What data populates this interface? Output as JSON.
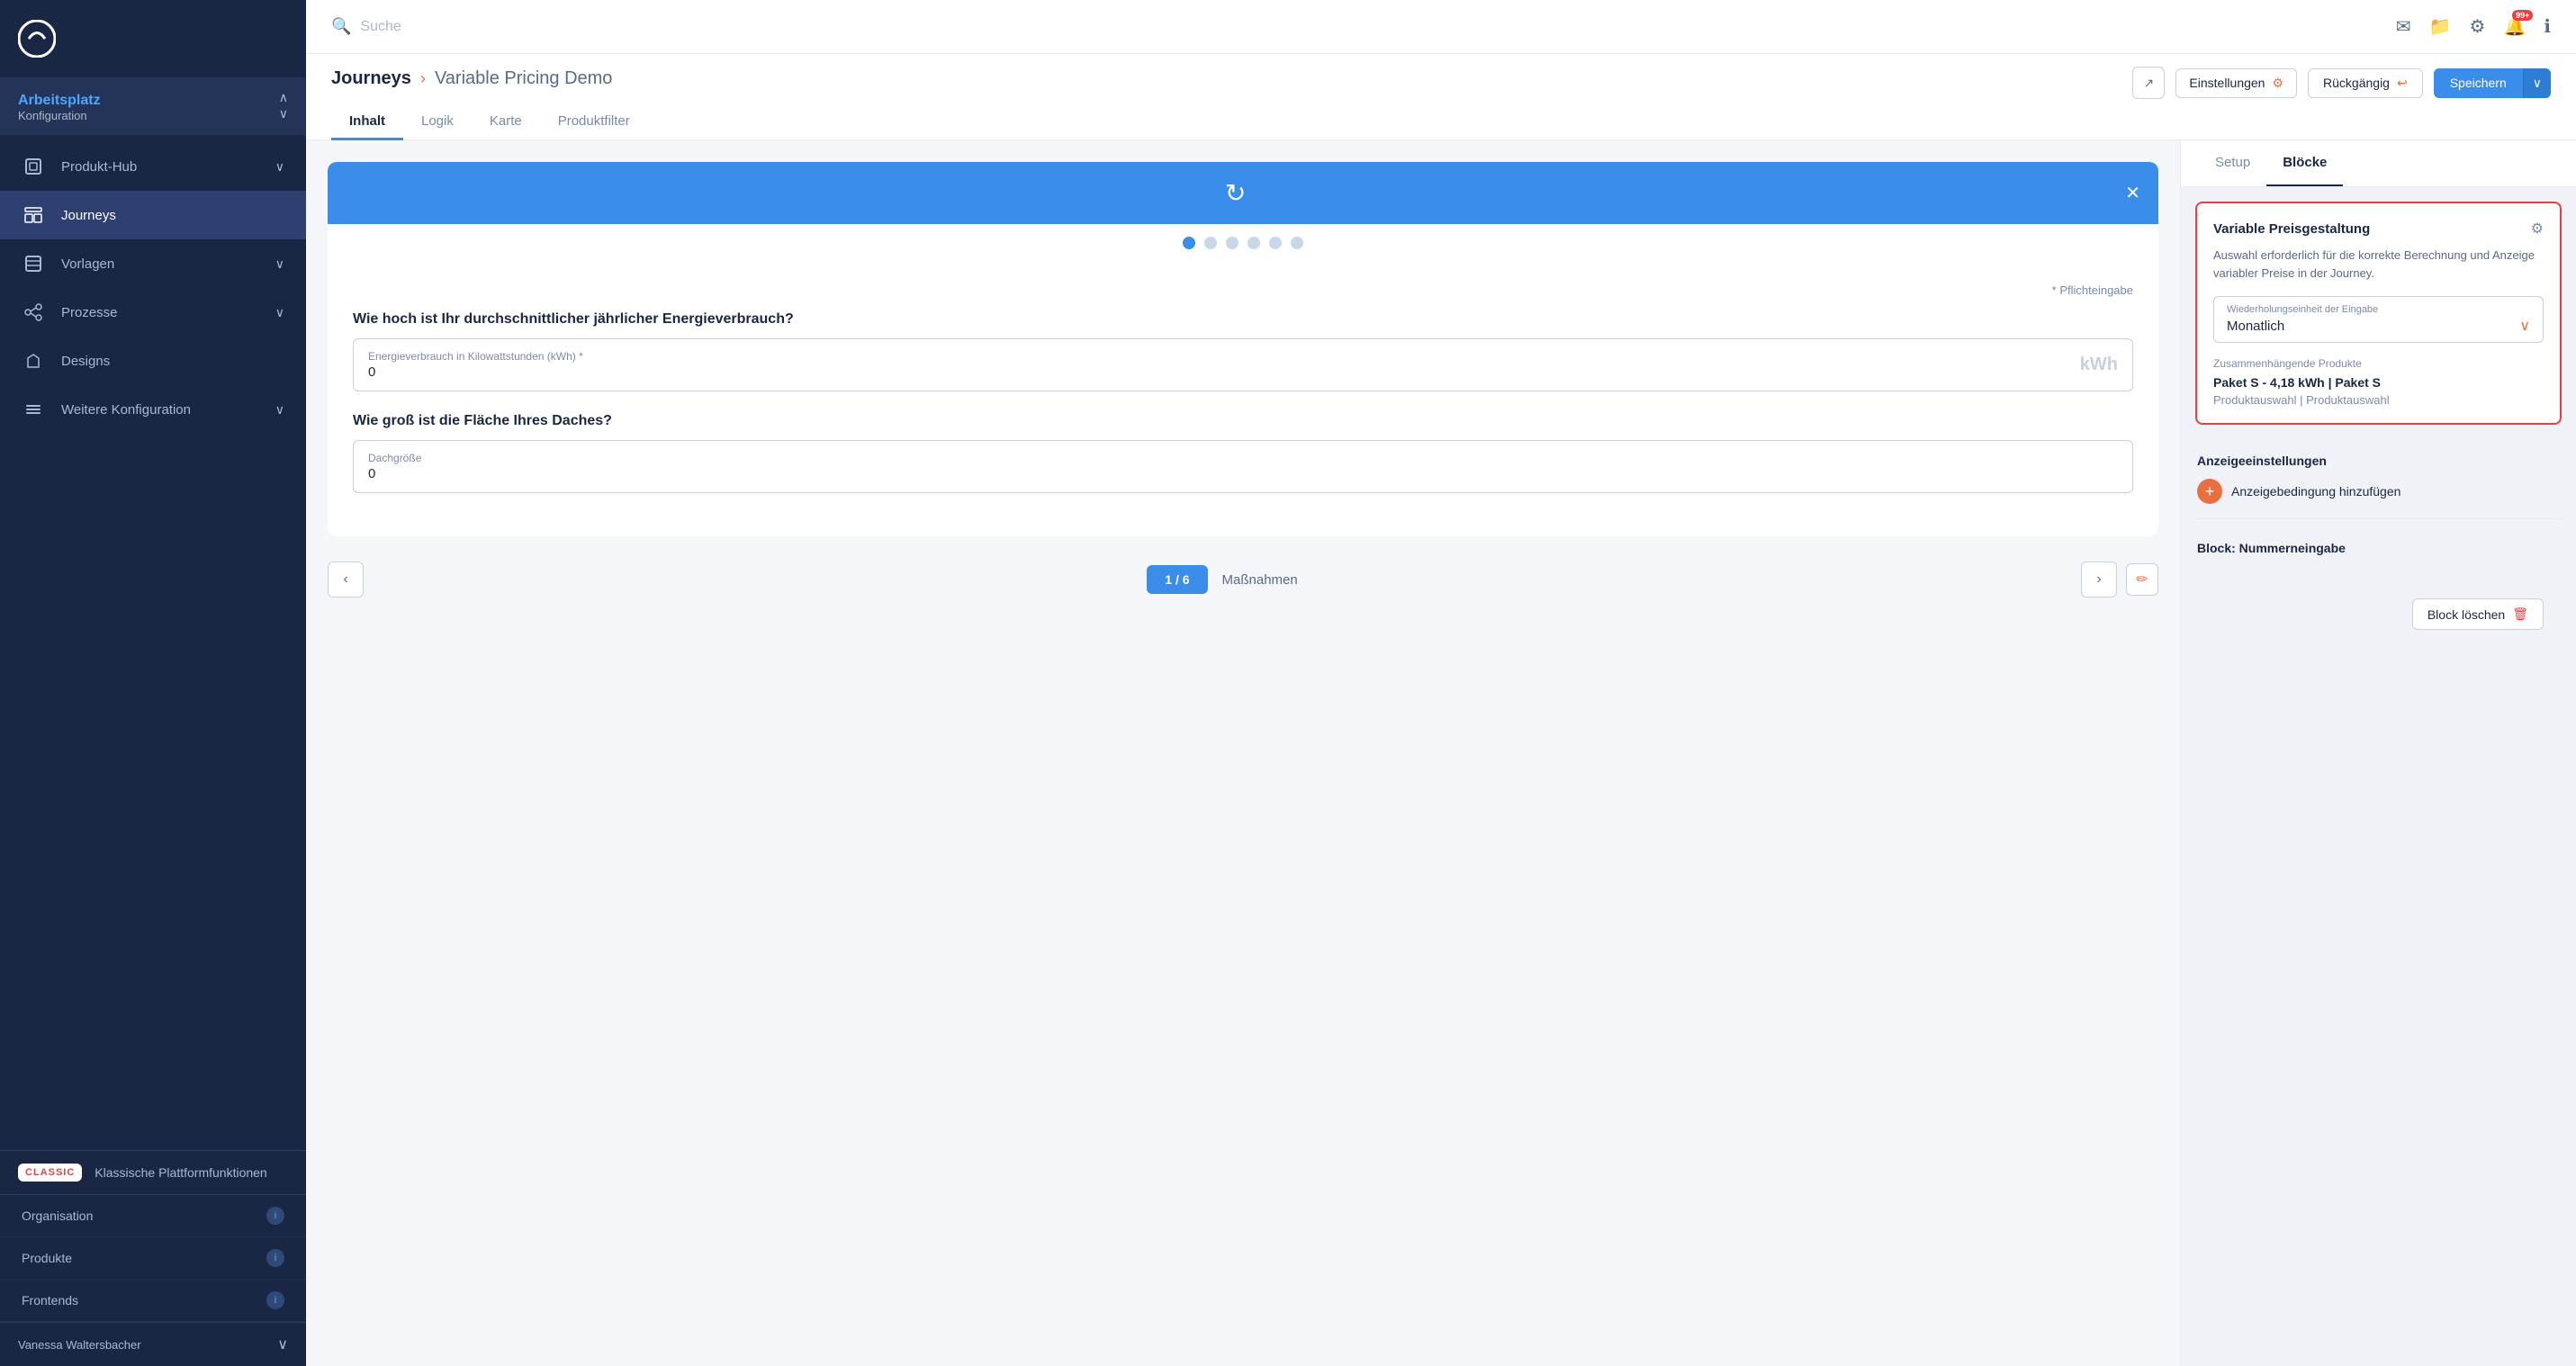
{
  "sidebar": {
    "logo_alt": "App Logo",
    "workspace": {
      "label": "Arbeitsplatz",
      "sublabel": "Konfiguration"
    },
    "nav_items": [
      {
        "id": "produkt-hub",
        "label": "Produkt-Hub",
        "icon": "cube",
        "has_arrow": true,
        "active": false
      },
      {
        "id": "journeys",
        "label": "Journeys",
        "icon": "layout",
        "has_arrow": false,
        "active": true
      },
      {
        "id": "vorlagen",
        "label": "Vorlagen",
        "icon": "template",
        "has_arrow": true,
        "active": false
      },
      {
        "id": "prozesse",
        "label": "Prozesse",
        "icon": "process",
        "has_arrow": true,
        "active": false
      },
      {
        "id": "designs",
        "label": "Designs",
        "icon": "design",
        "has_arrow": false,
        "active": false
      },
      {
        "id": "weitere",
        "label": "Weitere Konfiguration",
        "icon": "config",
        "has_arrow": true,
        "active": false
      }
    ],
    "classic_badge": "CLASSIC",
    "classic_label": "Klassische Plattformfunktionen",
    "bottom_items": [
      {
        "label": "Organisation",
        "has_info": true
      },
      {
        "label": "Produkte",
        "has_info": true
      },
      {
        "label": "Frontends",
        "has_info": true
      }
    ],
    "user_name": "Vanessa Waltersbacher"
  },
  "topbar": {
    "search_placeholder": "Suche",
    "icons": {
      "mail": "✉",
      "folder": "📁",
      "gear": "⚙",
      "bell": "🔔",
      "info": "ℹ"
    },
    "notification_count": "99+"
  },
  "header": {
    "breadcrumb_link": "Journeys",
    "arrow": "›",
    "current_page": "Variable Pricing Demo",
    "open_icon": "↗",
    "settings_label": "Einstellungen",
    "undo_label": "Rückgängig",
    "save_label": "Speichern"
  },
  "tabs": [
    {
      "id": "inhalt",
      "label": "Inhalt",
      "active": true
    },
    {
      "id": "logik",
      "label": "Logik",
      "active": false
    },
    {
      "id": "karte",
      "label": "Karte",
      "active": false
    },
    {
      "id": "produktfilter",
      "label": "Produktfilter",
      "active": false
    }
  ],
  "canvas": {
    "dots": [
      true,
      false,
      false,
      false,
      false,
      false
    ],
    "required_note": "* Pflichteingabe",
    "question1": "Wie hoch ist Ihr durchschnittlicher jährlicher Energieverbrauch?",
    "field1_label": "Energieverbrauch in Kilowattstunden (kWh) *",
    "field1_value": "0",
    "field1_unit": "kWh",
    "question2": "Wie groß ist die Fläche Ihres Daches?",
    "field2_label": "Dachgröße",
    "field2_value": "0",
    "footer": {
      "page_indicator": "1 / 6",
      "step_label": "Maßnahmen",
      "prev_arrow": "‹",
      "next_arrow": "›"
    }
  },
  "right_panel": {
    "tabs": [
      {
        "id": "setup",
        "label": "Setup",
        "active": false
      },
      {
        "id": "bloecke",
        "label": "Blöcke",
        "active": true
      }
    ],
    "block_card": {
      "title": "Variable Preisgestaltung",
      "settings_icon": "⚙",
      "description": "Auswahl erforderlich für die korrekte Berechnung und Anzeige variabler Preise in der Journey.",
      "select_label": "Wiederholungseinheit der Eingabe",
      "select_value": "Monatlich",
      "related_label": "Zusammenhängende Produkte",
      "related_value": "Paket S - 4,18 kWh | Paket S",
      "related_sub": "Produktauswahl | Produktauswahl"
    },
    "display_settings": {
      "title": "Anzeigeeinstellungen",
      "add_condition_label": "Anzeigebedingung hinzufügen"
    },
    "block_section": {
      "title": "Block: Nummerneingabe"
    },
    "delete_block_label": "Block löschen"
  }
}
